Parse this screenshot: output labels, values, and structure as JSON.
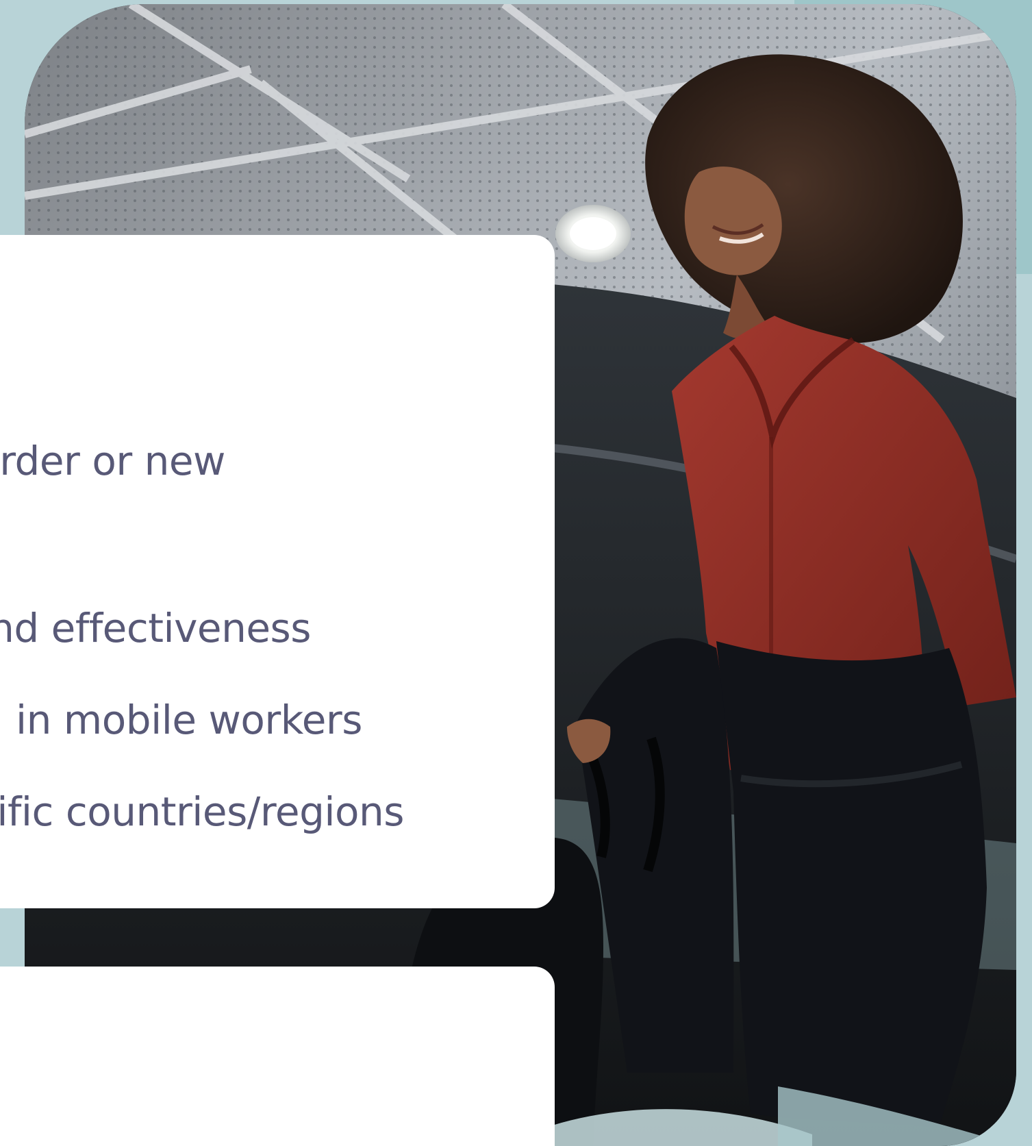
{
  "page": {
    "background_color": "#b8d3d7",
    "accent_teal": "#9ec6c9"
  },
  "hero_image": {
    "icon": "professional-woman-photo",
    "palette": {
      "ceiling": "#b7bcc2",
      "blouse": "#8b2f27",
      "skirt": "#111318",
      "skin": "#8b5a40",
      "hair": "#2b1d17"
    }
  },
  "benefits_card": {
    "items": [
      "rder or new",
      "nd effectiveness",
      "in mobile workers",
      "cific countries/regions"
    ]
  }
}
